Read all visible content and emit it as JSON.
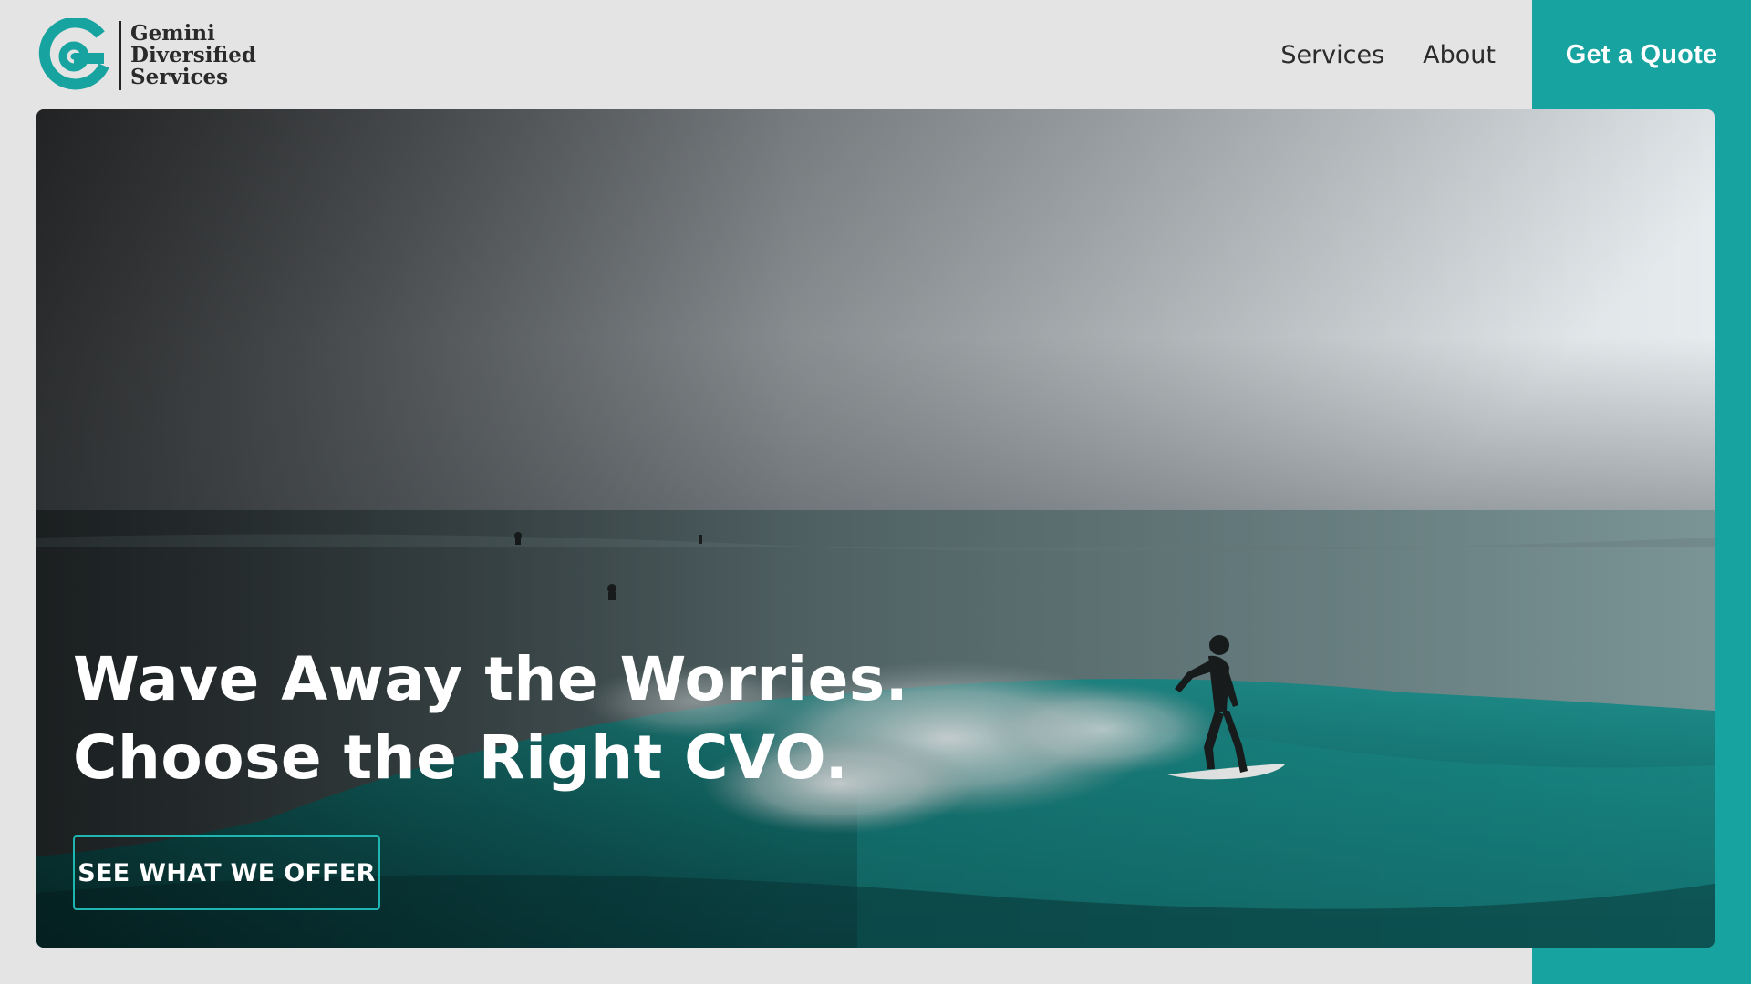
{
  "brand": {
    "name_lines": [
      "Gemini",
      "Diversified",
      "Services"
    ],
    "logo_icon": "gemini-g-logo-icon",
    "accent": "#17a3a0"
  },
  "nav": {
    "items": [
      {
        "label": "Services"
      },
      {
        "label": "About"
      }
    ],
    "cta_label": "Get a Quote"
  },
  "hero": {
    "headline_line1": "Wave Away the Worries.",
    "headline_line2": "Choose the Right CVO.",
    "button_label": "SEE WHAT WE OFFER",
    "image_subject": "surfer riding a teal wave under an overcast sky"
  },
  "colors": {
    "background": "#e4e4e4",
    "accent": "#17a3a0",
    "button_border": "#1fb5b1",
    "text_dark": "#2b2b2b"
  }
}
